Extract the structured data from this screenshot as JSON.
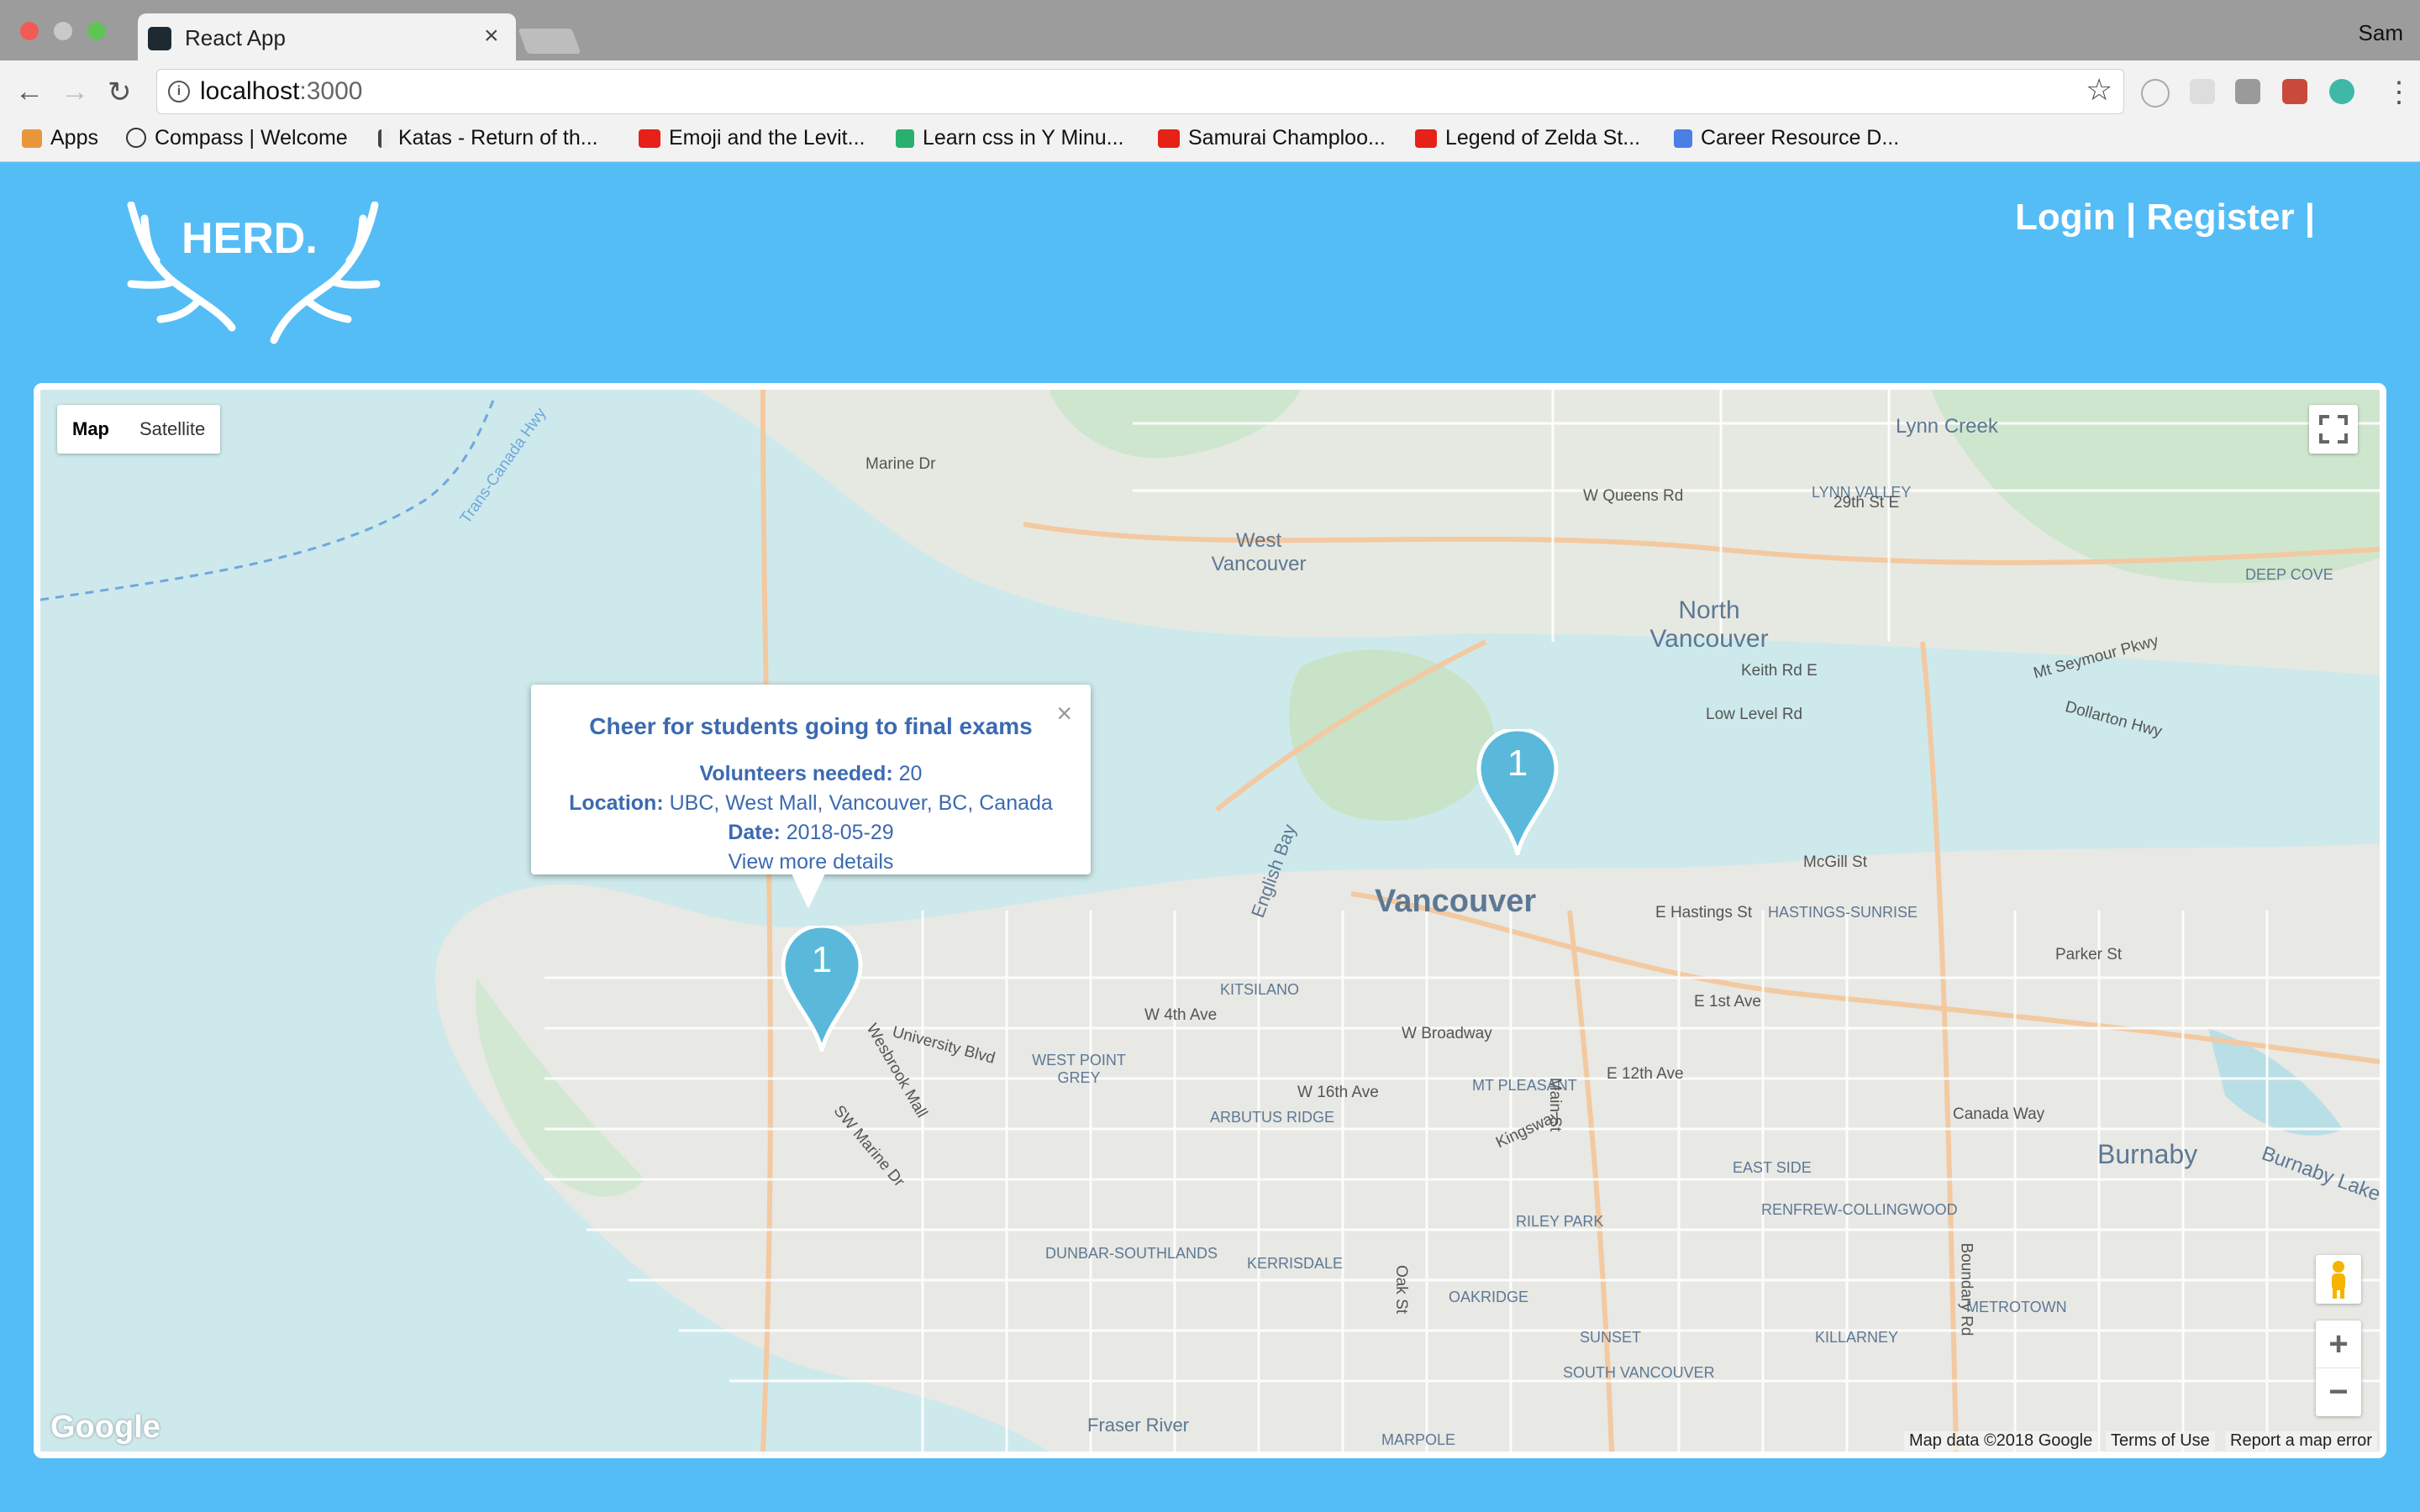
{
  "browser": {
    "tab_title": "React App",
    "user": "Sam",
    "url_host": "localhost",
    "url_port": ":3000",
    "bookmarks": [
      "Apps",
      "Compass | Welcome",
      "Katas - Return of th...",
      "Emoji and the Levit...",
      "Learn css in Y Minu...",
      "Samurai Champloo...",
      "Legend of Zelda St...",
      "Career Resource D..."
    ]
  },
  "header": {
    "logo": "HERD.",
    "auth": "Login | Register |"
  },
  "map": {
    "type_map": "Map",
    "type_satellite": "Satellite",
    "zoom_in": "+",
    "zoom_out": "−",
    "google": "Google",
    "attribution": [
      "Map data ©2018 Google",
      "Terms of Use",
      "Report a map error"
    ],
    "markers": [
      {
        "count": "1"
      },
      {
        "count": "1"
      }
    ],
    "labels": {
      "cities": [
        "Vancouver",
        "North Vancouver",
        "West Vancouver",
        "Burnaby",
        "Lynn Creek"
      ],
      "districts": [
        "KITSILANO",
        "WEST POINT GREY",
        "ARBUTUS RIDGE",
        "DUNBAR-SOUTHLANDS",
        "KERRISDALE",
        "OAKRIDGE",
        "MT PLEASANT",
        "RILEY PARK",
        "EAST SIDE",
        "RENFREW-COLLINGWOOD",
        "HASTINGS-SUNRISE",
        "SUNSET",
        "SOUTH VANCOUVER",
        "KILLARNEY",
        "METROTOWN",
        "MARPOLE",
        "LYNN VALLEY",
        "DEEP COVE"
      ],
      "streets": [
        "E Hastings St",
        "W 4th Ave",
        "W 16th Ave",
        "E 12th Ave",
        "Burnaby Lake",
        "English Bay",
        "Fraser River",
        "Canada Way",
        "Marine Dr",
        "Boundary Rd",
        "Kingsway",
        "Oak St",
        "Main St",
        "W Broadway",
        "Parker St",
        "Dollarton Hwy",
        "Mt Seymour Pkwy",
        "W Queens Rd",
        "29th St E",
        "Keith Rd E",
        "Low Level Rd",
        "McGill St",
        "E 1st Ave",
        "University Blvd",
        "SW Marine Dr",
        "Wesbrook Mall",
        "Trans-Canada Hwy"
      ]
    }
  },
  "event": {
    "title": "Cheer for students going to final exams",
    "volunteers_label": "Volunteers needed:",
    "volunteers_value": "20",
    "location_label": "Location:",
    "location_value": "UBC, West Mall, Vancouver, BC, Canada",
    "date_label": "Date:",
    "date_value": "2018-05-29",
    "details_link": "View more details"
  }
}
